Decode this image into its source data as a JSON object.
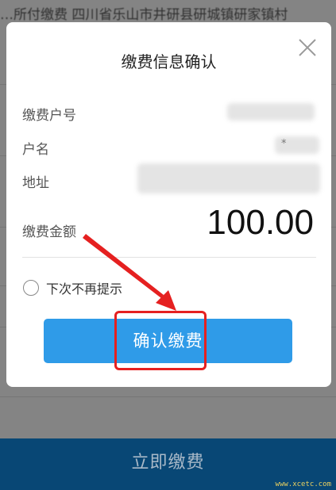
{
  "background": {
    "top_text": "…所付缴费   四川省乐山市井研县研城镇研家镇村",
    "pay_button_label": "立即缴费",
    "watermark": "www.xcetc.com"
  },
  "dialog": {
    "title": "缴费信息确认",
    "close_icon": "close-icon",
    "fields": {
      "account_label": "缴费户号",
      "name_label": "户名",
      "name_partial": "*",
      "address_label": "地址",
      "amount_label": "缴费金额",
      "amount_value": "100.00"
    },
    "dont_remind_label": "下次不再提示",
    "dont_remind_checked": false,
    "confirm_button_label": "确认缴费"
  },
  "colors": {
    "confirm_button": "#2f9be8",
    "pay_bar": "#0d6eb4",
    "annotation_red": "#e52020"
  }
}
